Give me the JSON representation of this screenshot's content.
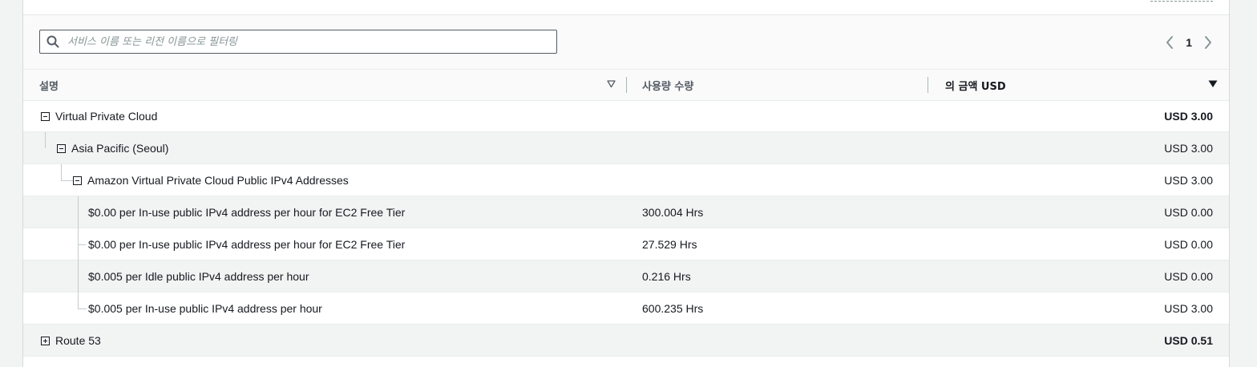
{
  "search": {
    "placeholder": "서비스 이름 또는 리전 이름으로 필터링"
  },
  "pagination": {
    "current_page": "1"
  },
  "table": {
    "headers": {
      "description": "설명",
      "usage": "사용량 수량",
      "amount": "의 금액 USD"
    },
    "rows": [
      {
        "label": "Virtual Private Cloud",
        "usage": "",
        "amount": "USD 3.00"
      },
      {
        "label": "Asia Pacific (Seoul)",
        "usage": "",
        "amount": "USD 3.00"
      },
      {
        "label": "Amazon Virtual Private Cloud Public IPv4 Addresses",
        "usage": "",
        "amount": "USD 3.00"
      },
      {
        "label": "$0.00 per In-use public IPv4 address per hour for EC2 Free Tier",
        "usage": "300.004 Hrs",
        "amount": "USD 0.00"
      },
      {
        "label": "$0.00 per In-use public IPv4 address per hour for EC2 Free Tier",
        "usage": "27.529 Hrs",
        "amount": "USD 0.00"
      },
      {
        "label": "$0.005 per Idle public IPv4 address per hour",
        "usage": "0.216 Hrs",
        "amount": "USD 0.00"
      },
      {
        "label": "$0.005 per In-use public IPv4 address per hour",
        "usage": "600.235 Hrs",
        "amount": "USD 3.00"
      },
      {
        "label": "Route 53",
        "usage": "",
        "amount": "USD 0.51"
      }
    ]
  }
}
